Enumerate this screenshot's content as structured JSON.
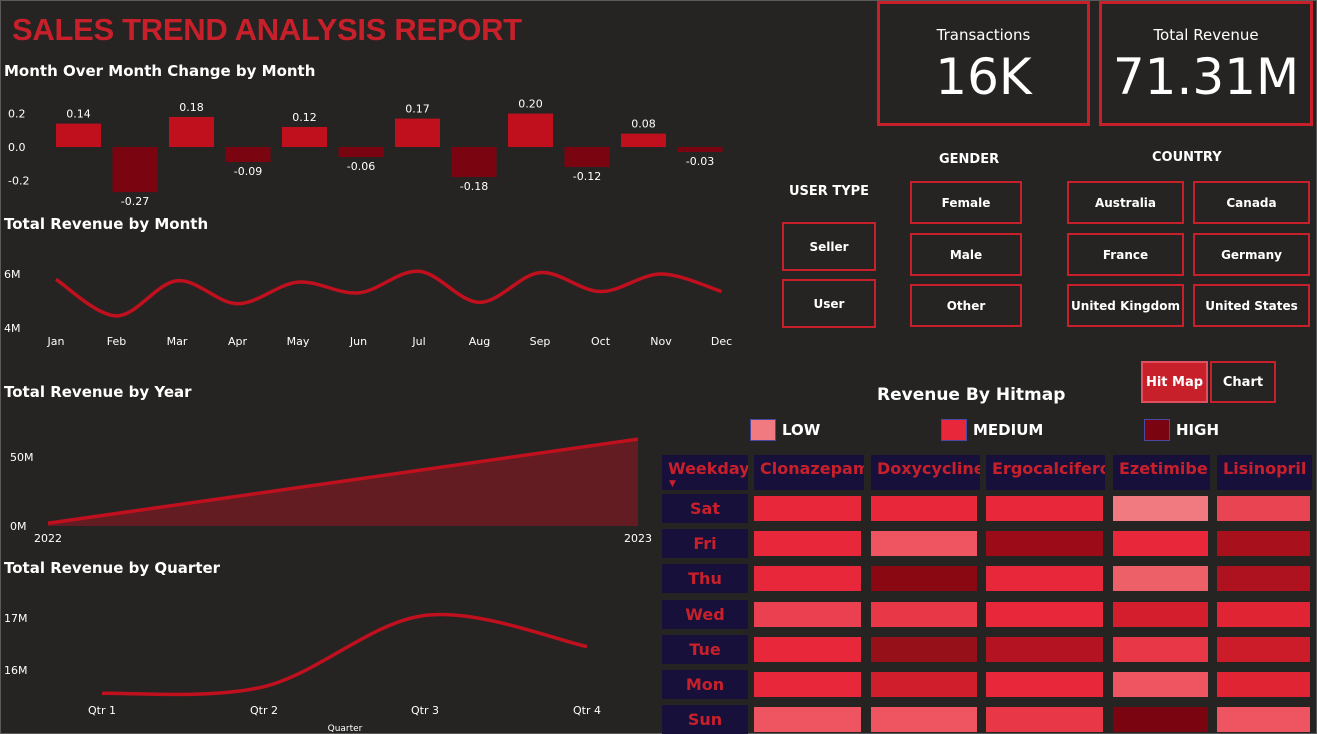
{
  "title": "SALES TREND ANALYSIS REPORT",
  "colors": {
    "accent": "#c8202b",
    "background": "#252423",
    "dark_red": "#7a0410",
    "navy": "#17103a"
  },
  "kpis": {
    "transactions_label": "Transactions",
    "transactions_value": "16K",
    "revenue_label": "Total Revenue",
    "revenue_value": "71.31M"
  },
  "slicers": {
    "user_type": {
      "title": "USER TYPE",
      "options": [
        "Seller",
        "User"
      ]
    },
    "gender": {
      "title": "GENDER",
      "options": [
        "Female",
        "Male",
        "Other"
      ]
    },
    "country": {
      "title": "COUNTRY",
      "options": [
        "Australia",
        "Canada",
        "France",
        "Germany",
        "United Kingdom",
        "United States"
      ]
    }
  },
  "toggle": {
    "hitmap_label": "Hit Map",
    "chart_label": "Chart",
    "active": "Hit Map"
  },
  "heatmap": {
    "title": "Revenue By Hitmap",
    "legend": [
      {
        "label": "LOW",
        "color": "#f07a80"
      },
      {
        "label": "MEDIUM",
        "color": "#e8283a"
      },
      {
        "label": "HIGH",
        "color": "#7a0410"
      }
    ],
    "corner_label": "Weekday",
    "columns": [
      "Clonazepam",
      "Doxycycline",
      "Ergocalciferol",
      "Ezetimibe",
      "Lisinopril"
    ],
    "rows": [
      {
        "day": "Sat",
        "colors": [
          "#e8283a",
          "#e8283a",
          "#e8283a",
          "#f07a80",
          "#e84452"
        ]
      },
      {
        "day": "Fri",
        "colors": [
          "#e8283a",
          "#ee5560",
          "#9c0c18",
          "#e8283a",
          "#a8101c"
        ]
      },
      {
        "day": "Thu",
        "colors": [
          "#e8283a",
          "#8a0812",
          "#e8283a",
          "#ee6068",
          "#ae121e"
        ]
      },
      {
        "day": "Wed",
        "colors": [
          "#ea4050",
          "#e83848",
          "#e8283a",
          "#d41e2e",
          "#e02434"
        ]
      },
      {
        "day": "Tue",
        "colors": [
          "#e8283a",
          "#96101a",
          "#b41422",
          "#e83848",
          "#cc1c2a"
        ]
      },
      {
        "day": "Mon",
        "colors": [
          "#e8283a",
          "#d01e2c",
          "#e8283a",
          "#ee5560",
          "#e02434"
        ]
      },
      {
        "day": "Sun",
        "colors": [
          "#ee5560",
          "#ee5560",
          "#e83848",
          "#7a0410",
          "#ee5560"
        ]
      }
    ]
  },
  "chart_data": [
    {
      "type": "bar",
      "title": "Month Over Month Change by Month",
      "categories": [
        "Jan",
        "Feb",
        "Mar",
        "Apr",
        "May",
        "Jun",
        "Jul",
        "Aug",
        "Sep",
        "Oct",
        "Nov",
        "Dec"
      ],
      "values": [
        0.14,
        -0.27,
        0.18,
        -0.09,
        0.12,
        -0.06,
        0.17,
        -0.18,
        0.2,
        -0.12,
        0.08,
        -0.03
      ],
      "data_labels": [
        "0.14",
        "-0.27",
        "0.18",
        "-0.09",
        "0.12",
        "-0.06",
        "0.17",
        "-0.18",
        "0.20",
        "-0.12",
        "0.08",
        "-0.03"
      ],
      "yticks": [
        "0.2",
        "0.0",
        "-0.2"
      ],
      "ylim": [
        -0.3,
        0.25
      ],
      "colors": {
        "positive": "#c0101e",
        "negative": "#7a0410"
      }
    },
    {
      "type": "line",
      "title": "Total Revenue by Month",
      "categories": [
        "Jan",
        "Feb",
        "Mar",
        "Apr",
        "May",
        "Jun",
        "Jul",
        "Aug",
        "Sep",
        "Oct",
        "Nov",
        "Dec"
      ],
      "values": [
        5.8,
        4.45,
        5.75,
        4.9,
        5.7,
        5.3,
        6.1,
        4.95,
        6.05,
        5.35,
        6.0,
        5.35
      ],
      "yticks": [
        "6M",
        "4M"
      ],
      "ylim": [
        3.9,
        6.8
      ],
      "color": "#c0101e"
    },
    {
      "type": "area",
      "title": "Total Revenue by Year",
      "categories": [
        "2022",
        "2023"
      ],
      "values": [
        2,
        63
      ],
      "yticks": [
        "50M",
        "0M"
      ],
      "ylim": [
        0,
        70
      ],
      "color": "#c0101e"
    },
    {
      "type": "line",
      "title": "Total Revenue by Quarter",
      "categories": [
        "Qtr 1",
        "Qtr 2",
        "Qtr 3",
        "Qtr 4"
      ],
      "values": [
        15.55,
        15.68,
        17.05,
        16.45
      ],
      "yticks": [
        "17M",
        "16M"
      ],
      "ylim": [
        15.3,
        17.4
      ],
      "xlabel": "Quarter",
      "color": "#c0101e"
    }
  ]
}
